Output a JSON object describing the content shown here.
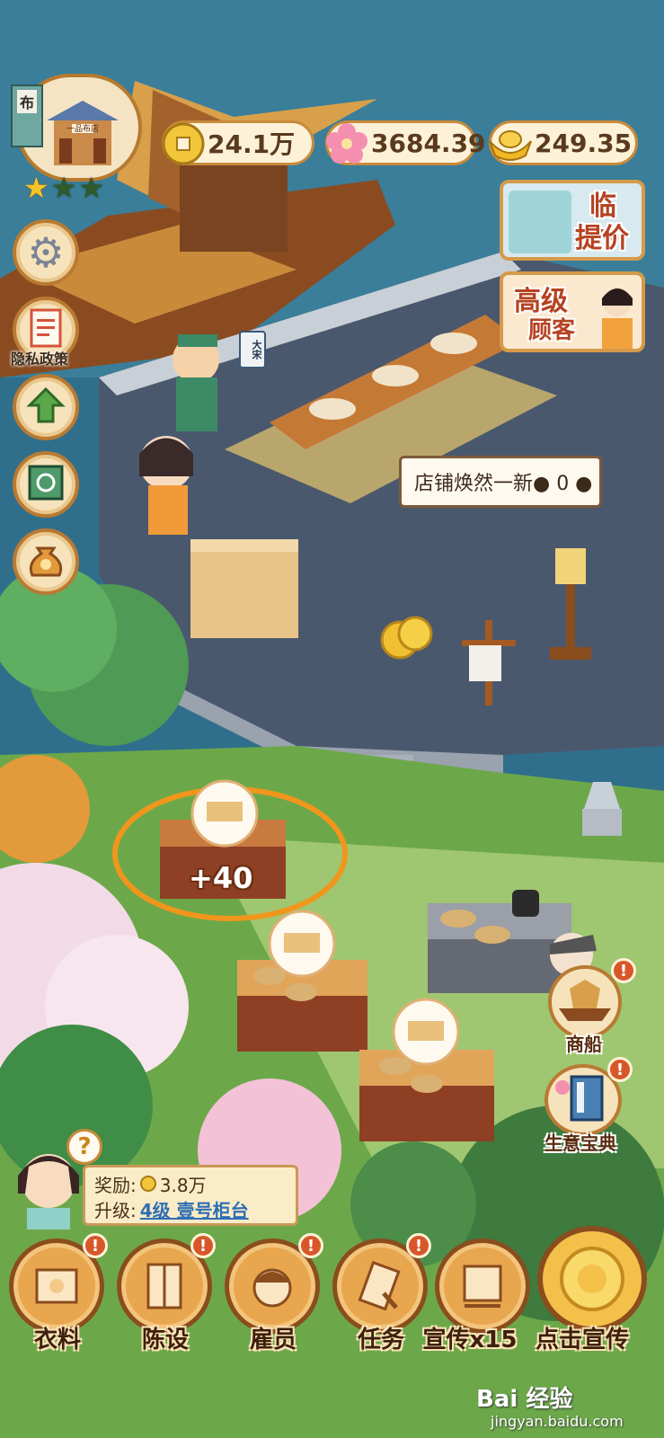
{
  "resources": {
    "coins": "24.1万",
    "flowers": "3684.39",
    "ingots": "249.35"
  },
  "shop": {
    "sign": "布",
    "name": "一品布店",
    "stars_filled": 1,
    "stars_total": 3
  },
  "left_menu": {
    "settings": "settings-gear",
    "privacy_label": "隐私政策",
    "upgrade": "upgrade-arrow",
    "map": "map-scroll",
    "bag": "money-bag"
  },
  "promos": {
    "price_raise": "临时\n提价",
    "price_raise_line1": "临时",
    "price_raise_line2": "提价",
    "vip_line1": "高级",
    "vip_line2": "顾客"
  },
  "banner_flag": "大宋",
  "tooltip": {
    "text": "店铺焕然一新● 0 ●"
  },
  "counter": {
    "plus": "+40"
  },
  "right_badges": {
    "ship_label": "商船",
    "guide_label": "生意宝典"
  },
  "reward": {
    "reward_label": "奖励:",
    "reward_value": "3.8万",
    "upgrade_label": "升级:",
    "upgrade_value": "4级 壹号柜台"
  },
  "bottom_nav": [
    {
      "label": "衣料"
    },
    {
      "label": "陈设"
    },
    {
      "label": "雇员"
    },
    {
      "label": "任务"
    },
    {
      "label": "宣传x15"
    },
    {
      "label": "点击宣传"
    }
  ],
  "watermark": {
    "brand": "Bai 经验",
    "url": "jingyan.baidu.com"
  },
  "colors": {
    "water": "#2f6f8c",
    "deck": "#4a586e",
    "grass": "#6ca84a",
    "wood": "#c98a3a",
    "accent_orange": "#f0961c"
  }
}
